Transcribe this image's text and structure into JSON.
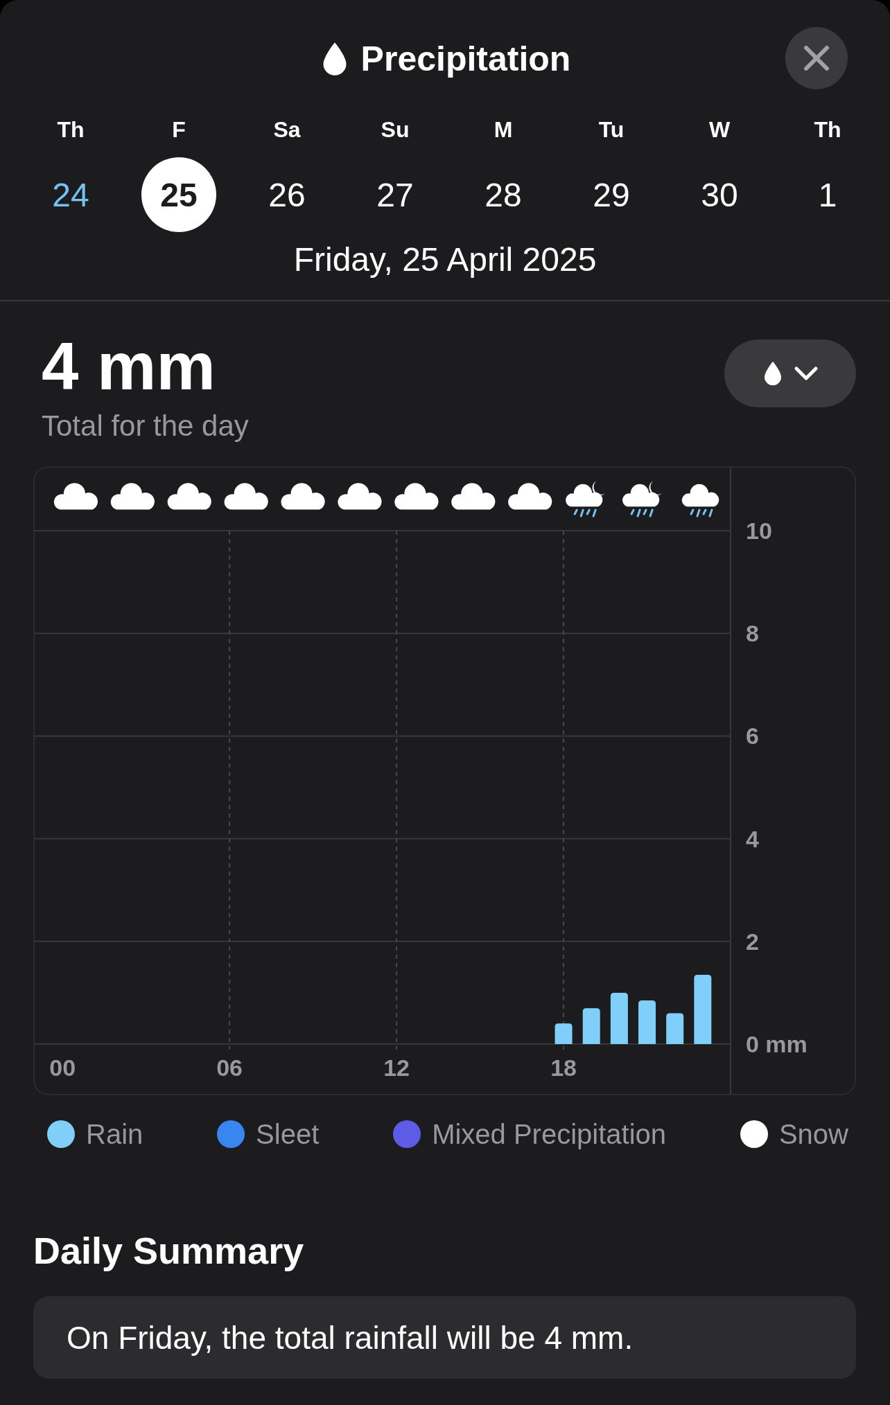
{
  "header": {
    "title": "Precipitation"
  },
  "days": [
    {
      "weekday": "Th",
      "date": "24",
      "selected": false,
      "today": true
    },
    {
      "weekday": "F",
      "date": "25",
      "selected": true,
      "today": false
    },
    {
      "weekday": "Sa",
      "date": "26",
      "selected": false,
      "today": false
    },
    {
      "weekday": "Su",
      "date": "27",
      "selected": false,
      "today": false
    },
    {
      "weekday": "M",
      "date": "28",
      "selected": false,
      "today": false
    },
    {
      "weekday": "Tu",
      "date": "29",
      "selected": false,
      "today": false
    },
    {
      "weekday": "W",
      "date": "30",
      "selected": false,
      "today": false
    },
    {
      "weekday": "Th",
      "date": "1",
      "selected": false,
      "today": false
    }
  ],
  "selected_date": "Friday, 25 April 2025",
  "total": {
    "value": "4 mm",
    "label": "Total for the day"
  },
  "chart": {
    "conditions": [
      {
        "kind": "cloud"
      },
      {
        "kind": "cloud"
      },
      {
        "kind": "cloud"
      },
      {
        "kind": "cloud"
      },
      {
        "kind": "cloud"
      },
      {
        "kind": "cloud"
      },
      {
        "kind": "cloud"
      },
      {
        "kind": "cloud"
      },
      {
        "kind": "cloud"
      },
      {
        "kind": "rain_moon"
      },
      {
        "kind": "rain_moon"
      },
      {
        "kind": "rain"
      }
    ],
    "chart_data": {
      "type": "bar",
      "x": [
        18,
        19,
        20,
        21,
        22,
        23
      ],
      "series": [
        {
          "color": "#7fcffa",
          "values": [
            0.4,
            0.7,
            1.0,
            0.85,
            0.6,
            1.35
          ]
        }
      ],
      "xlim": [
        -1,
        24
      ],
      "grid": true,
      "ylim": [
        0,
        10
      ],
      "yticks": [
        {
          "value": 0,
          "label": "0 mm"
        },
        2,
        4,
        6,
        8,
        10
      ],
      "xticks": [
        {
          "value": 0,
          "label": "00"
        },
        {
          "value": 6,
          "label": "06"
        },
        {
          "value": 12,
          "label": "12"
        },
        {
          "value": 18,
          "label": "18"
        }
      ]
    }
  },
  "legend": [
    {
      "label": "Rain",
      "color": "#7fcffa"
    },
    {
      "label": "Sleet",
      "color": "#3a86f0"
    },
    {
      "label": "Mixed Precipitation",
      "color": "#5e5ce6"
    },
    {
      "label": "Snow",
      "color": "#ffffff"
    }
  ],
  "summary": {
    "title": "Daily Summary",
    "text": "On Friday, the total rainfall will be 4 mm."
  }
}
